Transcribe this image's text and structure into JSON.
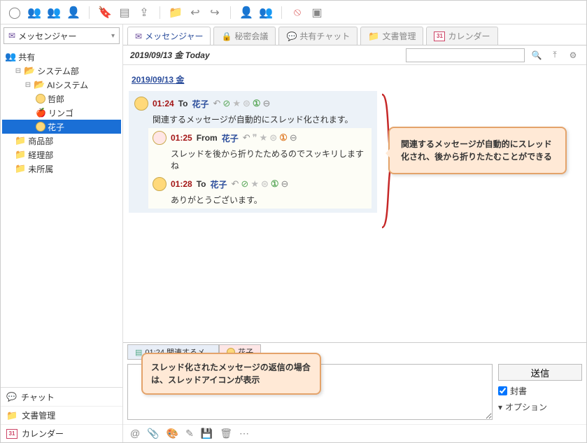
{
  "sidebar": {
    "dropdown_label": "メッセンジャー",
    "share_label": "共有",
    "tree": {
      "system": "システム部",
      "ai": "AIシステム",
      "tetsuro": "哲郎",
      "ringo": "リンゴ",
      "hanako": "花子",
      "sales": "商品部",
      "accounting": "経理部",
      "unassigned": "未所属"
    },
    "bottom": {
      "chat": "チャット",
      "docs": "文書管理",
      "calendar": "カレンダー",
      "calendar_day": "31"
    }
  },
  "tabs": {
    "messenger": "メッセンジャー",
    "secret": "秘密会議",
    "shared": "共有チャット",
    "docs": "文書管理",
    "calendar": "カレンダー",
    "calendar_day": "31"
  },
  "datebar": {
    "date": "2019/09/13 金 Today",
    "search_placeholder": ""
  },
  "thread": {
    "date_header": "2019/09/13 金",
    "m1": {
      "time": "01:24",
      "dir": "To",
      "name": "花子",
      "body": "関連するメッセージが自動的にスレッド化されます。"
    },
    "m2": {
      "time": "01:25",
      "dir": "From",
      "name": "花子",
      "body": "スレッドを後から折りたためるのでスッキリしますね"
    },
    "m3": {
      "time": "01:28",
      "dir": "To",
      "name": "花子",
      "body": "ありがとうございます。"
    }
  },
  "callouts": {
    "c1": "関連するメッセージが自動的にスレッド化され、後から折りたたむことができる",
    "c2": "スレッド化されたメッセージの返信の場合は、スレッドアイコンが表示"
  },
  "compose": {
    "tab1": "01:24 関連するメ...",
    "tab2": "花子",
    "send": "送信",
    "sealed": "封書",
    "options": "オプション"
  }
}
